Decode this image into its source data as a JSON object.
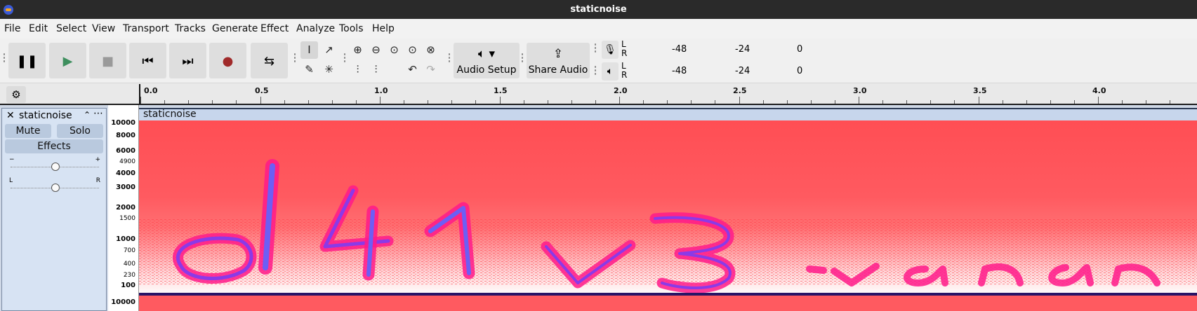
{
  "window": {
    "title": "staticnoise"
  },
  "menu": [
    "File",
    "Edit",
    "Select",
    "View",
    "Transport",
    "Tracks",
    "Generate",
    "Effect",
    "Analyze",
    "Tools",
    "Help"
  ],
  "transport": {
    "pause_icon": "pause-icon",
    "play_icon": "play-icon",
    "stop_icon": "stop-icon",
    "skip_start_icon": "skip-to-start-icon",
    "skip_end_icon": "skip-to-end-icon",
    "record_icon": "record-icon",
    "loop_icon": "loop-icon"
  },
  "audio_setup": {
    "label": "Audio Setup"
  },
  "share_audio": {
    "label": "Share Audio"
  },
  "meters": {
    "record": {
      "l": "L",
      "r": "R",
      "tick1": "-48",
      "tick2": "-24",
      "end": "0"
    },
    "playback": {
      "l": "L",
      "r": "R",
      "tick1": "-48",
      "tick2": "-24",
      "end": "0"
    }
  },
  "ruler": {
    "labels": [
      "0.0",
      "0.5",
      "1.0",
      "1.5",
      "2.0",
      "2.5",
      "3.0",
      "3.5",
      "4.0"
    ]
  },
  "track": {
    "name": "staticnoise",
    "mute": "Mute",
    "solo": "Solo",
    "effects": "Effects",
    "gain_minus": "−",
    "gain_plus": "+",
    "pan_left": "L",
    "pan_right": "R",
    "clip_name": "staticnoise"
  },
  "freq_labels": [
    "10000",
    "8000",
    "6000",
    "4900",
    "4000",
    "3000",
    "2000",
    "1500",
    "1000",
    "700",
    "400",
    "230",
    "100",
    "10000"
  ],
  "spectrogram_text": "d41v3.van",
  "colors": {
    "spectrogram_bg": "#ff5a60",
    "ink": "#7a3cf0",
    "noise": "#ffffff"
  }
}
